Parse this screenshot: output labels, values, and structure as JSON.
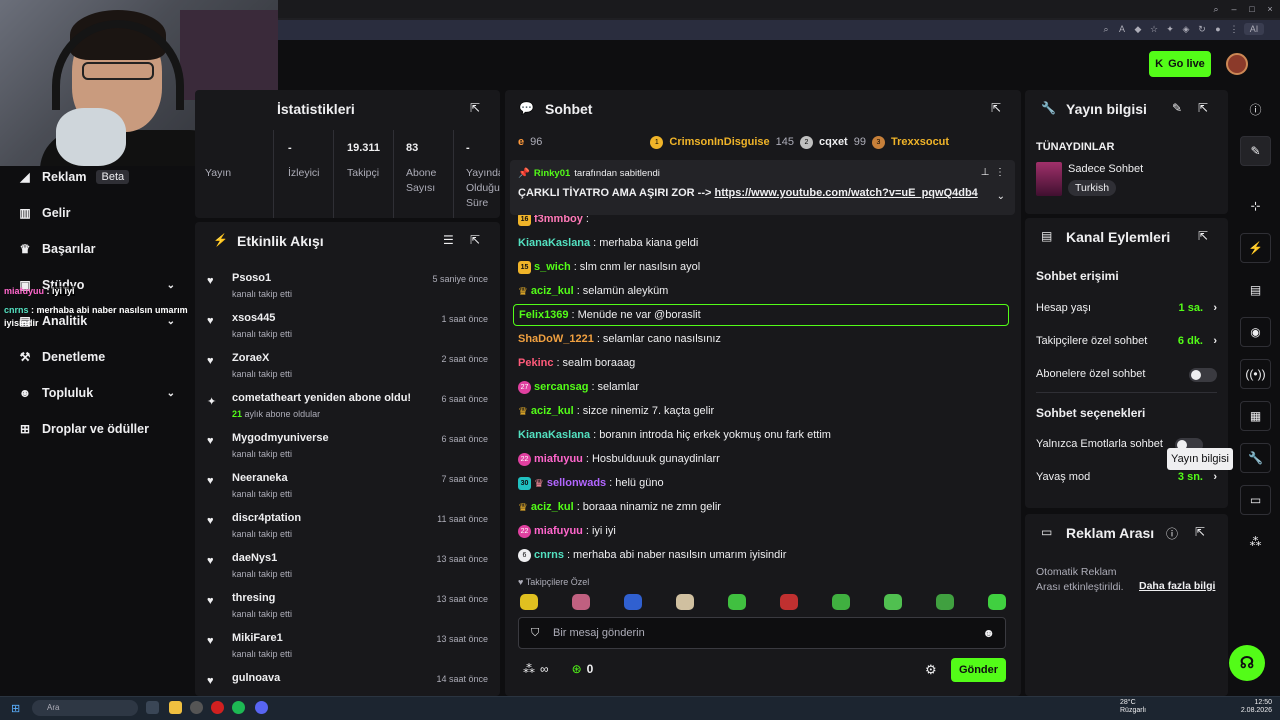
{
  "header": {
    "go_live_label": "Go live"
  },
  "sidebar": {
    "items": [
      {
        "label": "Reklam",
        "badge": "Beta",
        "icon": "megaphone-icon"
      },
      {
        "label": "Gelir",
        "icon": "chart-icon"
      },
      {
        "label": "Başarılar",
        "icon": "trophy-icon"
      },
      {
        "label": "Stüdyo",
        "icon": "studio-icon"
      },
      {
        "label": "Analitik",
        "icon": "analytics-icon"
      },
      {
        "label": "Denetleme",
        "icon": "hammer-icon"
      },
      {
        "label": "Topluluk",
        "icon": "people-icon"
      },
      {
        "label": "Droplar ve ödüller",
        "icon": "gift-icon"
      }
    ]
  },
  "overlay_chat": [
    {
      "user": "miafuyuu",
      "text": "iyi iyi"
    },
    {
      "user": "cnrns",
      "text": "merhaba abi naber nasılsın umarım iyisindir"
    }
  ],
  "stats": {
    "title": "İstatistikleri",
    "cols": [
      {
        "value": "",
        "label": "Yayın"
      },
      {
        "value": "-",
        "label": "İzleyici"
      },
      {
        "value": "19.311",
        "label": "Takipçi"
      },
      {
        "value": "83",
        "label": "Abone Sayısı"
      },
      {
        "value": "-",
        "label": "Yayında Olduğu Süre"
      }
    ]
  },
  "activity": {
    "title": "Etkinlik Akışı",
    "rows": [
      {
        "name": "Psoso1",
        "sub": "kanalı takip etti",
        "time": "5 saniye önce"
      },
      {
        "name": "xsos445",
        "sub": "kanalı takip etti",
        "time": "1 saat önce"
      },
      {
        "name": "ZoraeX",
        "sub": "kanalı takip etti",
        "time": "2 saat önce"
      },
      {
        "name": "cometatheart yeniden abone oldu!",
        "sub_hl": "21",
        "sub": "aylık abone oldular",
        "time": "6 saat önce"
      },
      {
        "name": "Mygodmyuniverse",
        "sub": "kanalı takip etti",
        "time": "6 saat önce"
      },
      {
        "name": "Neeraneka",
        "sub": "kanalı takip etti",
        "time": "7 saat önce"
      },
      {
        "name": "discr4ptation",
        "sub": "kanalı takip etti",
        "time": "11 saat önce"
      },
      {
        "name": "daeNys1",
        "sub": "kanalı takip etti",
        "time": "13 saat önce"
      },
      {
        "name": "thresing",
        "sub": "kanalı takip etti",
        "time": "13 saat önce"
      },
      {
        "name": "MikiFare1",
        "sub": "kanalı takip etti",
        "time": "13 saat önce"
      },
      {
        "name": "gulnoava",
        "sub": "",
        "time": "14 saat önce"
      }
    ]
  },
  "chat": {
    "title": "Sohbet",
    "leaderboard": [
      {
        "rank": "",
        "name": "e",
        "score": "96"
      },
      {
        "rank": "1",
        "name": "CrimsonInDisguise",
        "score": "145"
      },
      {
        "rank": "2",
        "name": "cqxet",
        "score": "99"
      },
      {
        "rank": "3",
        "name": "Trexxsocut",
        "score": ""
      }
    ],
    "pinned": {
      "by_user": "Rinky01",
      "by_text": "tarafından sabitlendi",
      "message": "ÇARKLI TİYATRO AMA AŞIRI ZOR --> ",
      "link": "https://www.youtube.com/watch?v=uE_pqwQ4db4"
    },
    "messages": [
      {
        "badge": "16",
        "user": "f3mmboy",
        "text": "",
        "color": "#ff7ab8"
      },
      {
        "badge": "",
        "user": "KianaKaslana",
        "text": "merhaba kiana geldi",
        "color": "#53e0c0"
      },
      {
        "badge": "15",
        "user": "s_wich",
        "text": "slm cnm ler nasılsın ayol",
        "color": "#53fc18"
      },
      {
        "badge": "crown",
        "user": "aciz_kul",
        "text": "selamün aleyküm",
        "color": "#53fc18"
      },
      {
        "badge": "",
        "user": "Felix1369",
        "text": "Menüde ne var @boraslit",
        "color": "#53fc18"
      },
      {
        "badge": "",
        "user": "ShaDoW_1221",
        "text": "selamlar cano nasılsınız",
        "color": "#f0a040"
      },
      {
        "badge": "",
        "user": "Pekinc",
        "text": "sealm boraaag",
        "color": "#ff5a7a"
      },
      {
        "badge": "27",
        "user": "sercansag",
        "text": "selamlar",
        "color": "#53fc18"
      },
      {
        "badge": "crown",
        "user": "aciz_kul",
        "text": "sizce ninemiz 7. kaçta gelir",
        "color": "#53fc18"
      },
      {
        "badge": "",
        "user": "KianaKaslana",
        "text": "boranın introda hiç erkek yokmuş onu fark ettim",
        "color": "#53e0c0"
      },
      {
        "badge": "22",
        "user": "miafuyuu",
        "text": "Hosbulduuuk gunaydinlarr",
        "color": "#ff66cc"
      },
      {
        "badge": "30",
        "user": "sellonwads",
        "text": "helü güno",
        "color": "#b266ff"
      },
      {
        "badge": "crown",
        "user": "aciz_kul",
        "text": "boraaa ninamiz ne zmn gelir",
        "color": "#53fc18"
      },
      {
        "badge": "22",
        "user": "miafuyuu",
        "text": "iyi iyi",
        "color": "#ff66cc"
      },
      {
        "badge": "6",
        "user": "cnrns",
        "text": "merhaba abi naber nasılsın umarım iyisindir",
        "color": "#53e0c0"
      }
    ],
    "followers_only": "Takipçilere Özel",
    "input_placeholder": "Bir mesaj gönderin",
    "infinity": "∞",
    "points": "0",
    "send_label": "Gönder"
  },
  "stream_info": {
    "title": "Yayın bilgisi",
    "stream_title": "TÜNAYDINLAR",
    "category": "Sadece Sohbet",
    "tag": "Turkish"
  },
  "channel_actions": {
    "title": "Kanal Eylemleri",
    "access_header": "Sohbet erişimi",
    "rows": [
      {
        "label": "Hesap yaşı",
        "value": "1 sa."
      },
      {
        "label": "Takipçilere özel sohbet",
        "value": "6 dk."
      },
      {
        "label": "Abonelere özel sohbet",
        "value": ""
      }
    ],
    "options_header": "Sohbet seçenekleri",
    "emote_only": "Yalnızca Emotlarla sohbet",
    "slow_mode": "Yavaş mod",
    "slow_value": "3 sn."
  },
  "ad_break": {
    "title": "Reklam Arası",
    "desc": "Otomatik Reklam Arası etkinleştirildi.",
    "link": "Daha fazla bilgi"
  },
  "tooltip": "Yayın bilgisi",
  "taskbar": {
    "search": "Ara",
    "weather": "28°C",
    "weather_sub": "Rüzgarlı",
    "time": "12:50",
    "date": "2.08.2026"
  },
  "colors": {
    "accent": "#53fc18",
    "panel": "#18181b",
    "bg": "#0e0e10"
  }
}
